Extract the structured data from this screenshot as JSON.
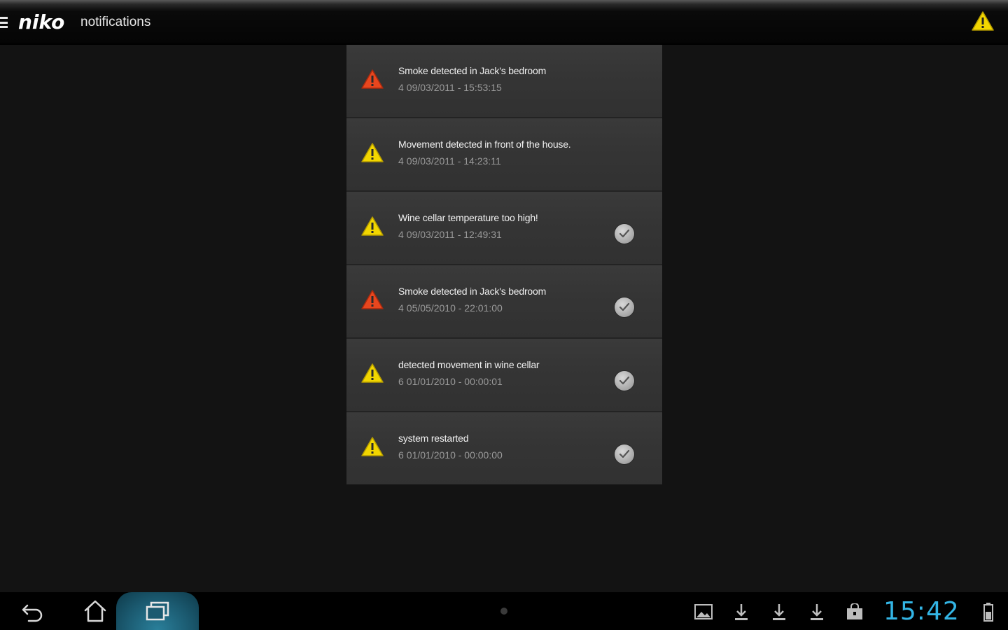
{
  "action_bar": {
    "logo": "niko",
    "title": "notifications",
    "icons": {
      "menu": "menu-icon",
      "alert": "warning-icon"
    }
  },
  "notifications": [
    {
      "message": "Smoke detected in Jack's bedroom",
      "count": "4",
      "timestamp": "09/03/2011 - 15:53:15",
      "severity": "alarm",
      "acknowledged": false
    },
    {
      "message": "Movement detected in front of the house.",
      "count": "4",
      "timestamp": "09/03/2011 - 14:23:11",
      "severity": "warning",
      "acknowledged": false
    },
    {
      "message": "Wine cellar temperature too high!",
      "count": "4",
      "timestamp": "09/03/2011 - 12:49:31",
      "severity": "warning",
      "acknowledged": true
    },
    {
      "message": "Smoke detected in Jack's bedroom",
      "count": "4",
      "timestamp": "05/05/2010 - 22:01:00",
      "severity": "alarm",
      "acknowledged": true
    },
    {
      "message": "detected movement in wine cellar",
      "count": "6",
      "timestamp": "01/01/2010 - 00:00:01",
      "severity": "warning",
      "acknowledged": true
    },
    {
      "message": "system restarted",
      "count": "6",
      "timestamp": "01/01/2010 - 00:00:00",
      "severity": "warning",
      "acknowledged": true
    }
  ],
  "colors": {
    "alarm": "#e8461e",
    "warning": "#f2d600",
    "clock": "#33b5e5"
  },
  "system_bar": {
    "clock": "15:42",
    "nav": [
      "back-icon",
      "home-icon",
      "recent-apps-icon"
    ],
    "status_icons": [
      "gallery-icon",
      "download-icon",
      "download-icon",
      "download-icon",
      "store-icon",
      "battery-icon"
    ]
  }
}
